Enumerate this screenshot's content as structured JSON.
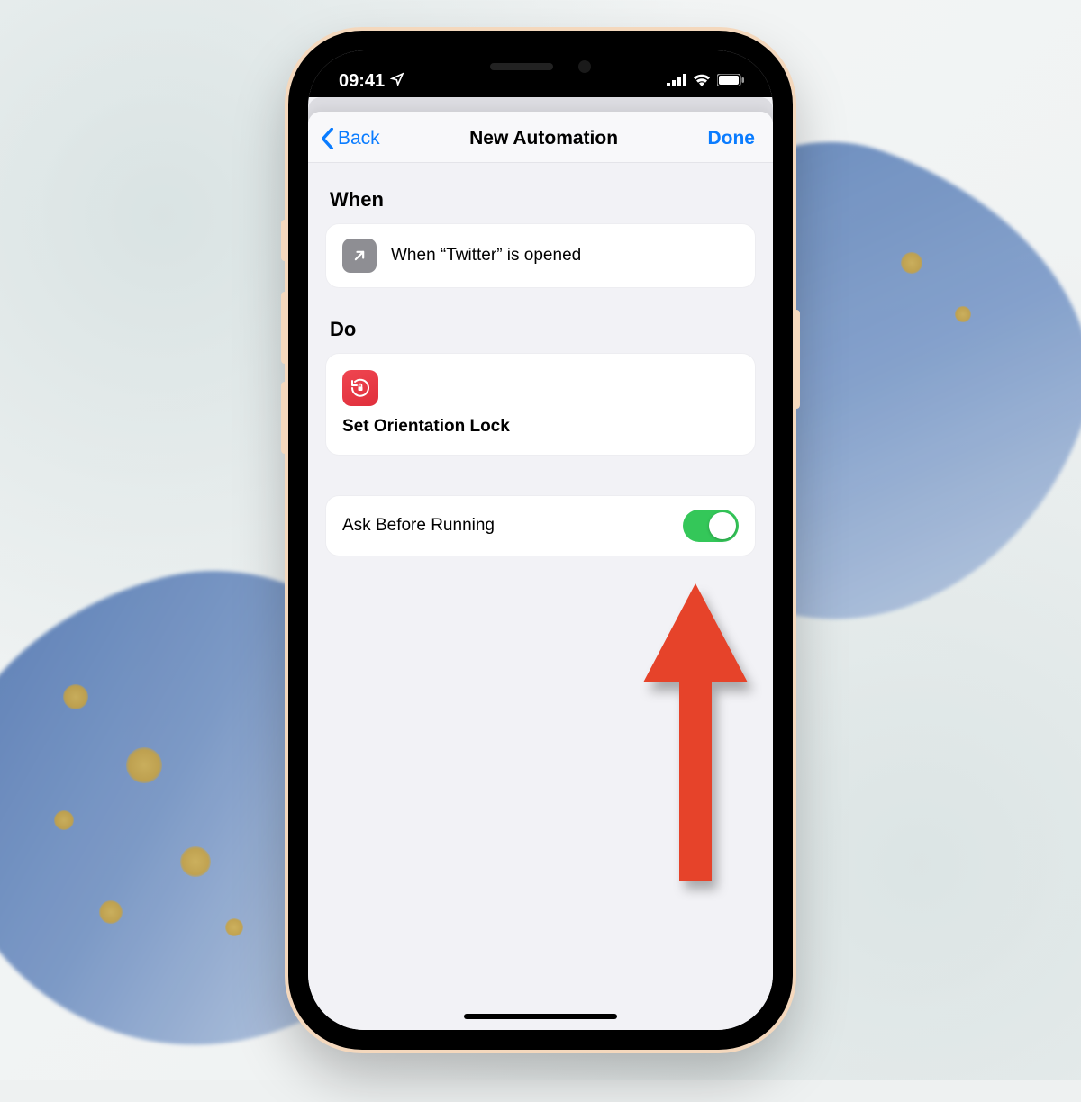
{
  "status": {
    "time": "09:41",
    "location_icon": "location-arrow",
    "signal": "cellular-4-bars",
    "wifi": "wifi-3-bars",
    "battery": "battery-full"
  },
  "nav": {
    "back_label": "Back",
    "title": "New Automation",
    "done_label": "Done"
  },
  "sections": {
    "when": {
      "title": "When"
    },
    "do": {
      "title": "Do"
    }
  },
  "when_card": {
    "icon": "open-app-arrow",
    "text": "When “Twitter” is opened"
  },
  "do_card": {
    "icon": "orientation-lock",
    "label": "Set Orientation Lock",
    "icon_color": "#e7343f"
  },
  "toggle": {
    "label": "Ask Before Running",
    "state_on": true,
    "on_color": "#34c759"
  },
  "annotation": {
    "type": "arrow-up-red",
    "target": "ask-before-running-toggle",
    "color": "#e6432a"
  }
}
